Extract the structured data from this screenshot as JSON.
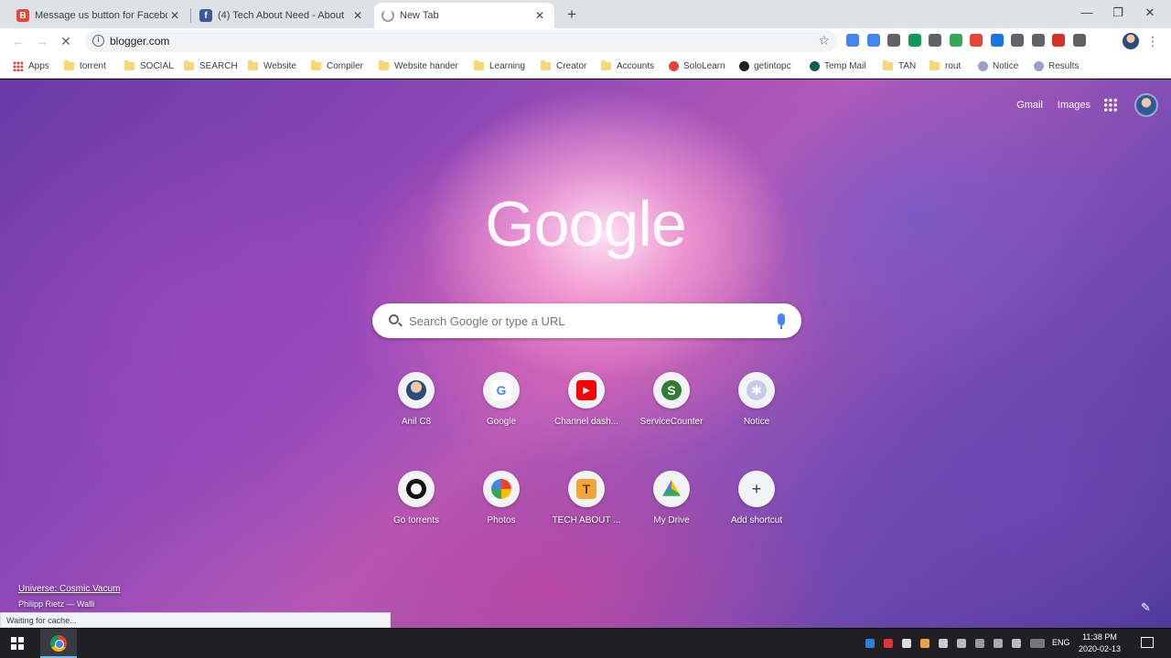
{
  "tabs": [
    {
      "title": "Message us button for Facebook",
      "favicon_color": "#e8453c",
      "active": false
    },
    {
      "title": "(4) Tech About Need - About",
      "favicon_color": "#3b5998",
      "active": false
    },
    {
      "title": "New Tab",
      "favicon_color": "#9aa0a6",
      "active": true
    }
  ],
  "toolbar": {
    "url": "blogger.com",
    "extension_colors": [
      "#4285f4",
      "#4285f4",
      "#5f6368",
      "#0f9d58",
      "#5f6368",
      "#34a853",
      "#ea4335",
      "#1a73e8",
      "#5f6368",
      "#5f6368",
      "#d93025",
      "#5f6368"
    ]
  },
  "bookmarks": [
    {
      "label": "Apps",
      "type": "apps"
    },
    {
      "label": "torrent",
      "type": "folder"
    },
    {
      "label": "SOCIAL",
      "type": "folder"
    },
    {
      "label": "SEARCH",
      "type": "folder"
    },
    {
      "label": "Website",
      "type": "folder"
    },
    {
      "label": "Compiler",
      "type": "folder"
    },
    {
      "label": "Website hander",
      "type": "folder"
    },
    {
      "label": "Learning",
      "type": "folder"
    },
    {
      "label": "Creator",
      "type": "folder"
    },
    {
      "label": "Accounts",
      "type": "folder"
    },
    {
      "label": "SoloLearn",
      "type": "site",
      "color": "#ea4335"
    },
    {
      "label": "getintopc",
      "type": "site",
      "color": "#202124"
    },
    {
      "label": "Temp Mail",
      "type": "site",
      "color": "#0d5f55"
    },
    {
      "label": "TAN",
      "type": "folder"
    },
    {
      "label": "rout",
      "type": "folder"
    },
    {
      "label": "Notice",
      "type": "site",
      "color": "#9aa0c8"
    },
    {
      "label": "Results",
      "type": "site",
      "color": "#9aa0c8"
    }
  ],
  "header_links": {
    "gmail": "Gmail",
    "images": "Images"
  },
  "google_logo": "Google",
  "search": {
    "placeholder": "Search Google or type a URL"
  },
  "shortcuts": [
    {
      "label": "Anil C8",
      "icon": "avatar-icon"
    },
    {
      "label": "Google",
      "icon": "google-g-icon"
    },
    {
      "label": "Channel dash...",
      "icon": "youtube-icon"
    },
    {
      "label": "ServiceCounter",
      "icon": "service-counter-icon"
    },
    {
      "label": "Notice",
      "icon": "notice-icon"
    },
    {
      "label": "Go torrents",
      "icon": "torrent-icon"
    },
    {
      "label": "Photos",
      "icon": "photos-icon"
    },
    {
      "label": "TECH ABOUT ...",
      "icon": "tech-about-icon"
    },
    {
      "label": "My Drive",
      "icon": "drive-icon"
    },
    {
      "label": "Add shortcut",
      "icon": "plus-icon"
    }
  ],
  "background": {
    "title": "Universe: Cosmic Vacum",
    "author": "Philipp Rietz — Walli"
  },
  "status_text": "Waiting for cache...",
  "taskbar": {
    "language": "ENG",
    "time": "11:38 PM",
    "date": "2020-02-13"
  }
}
